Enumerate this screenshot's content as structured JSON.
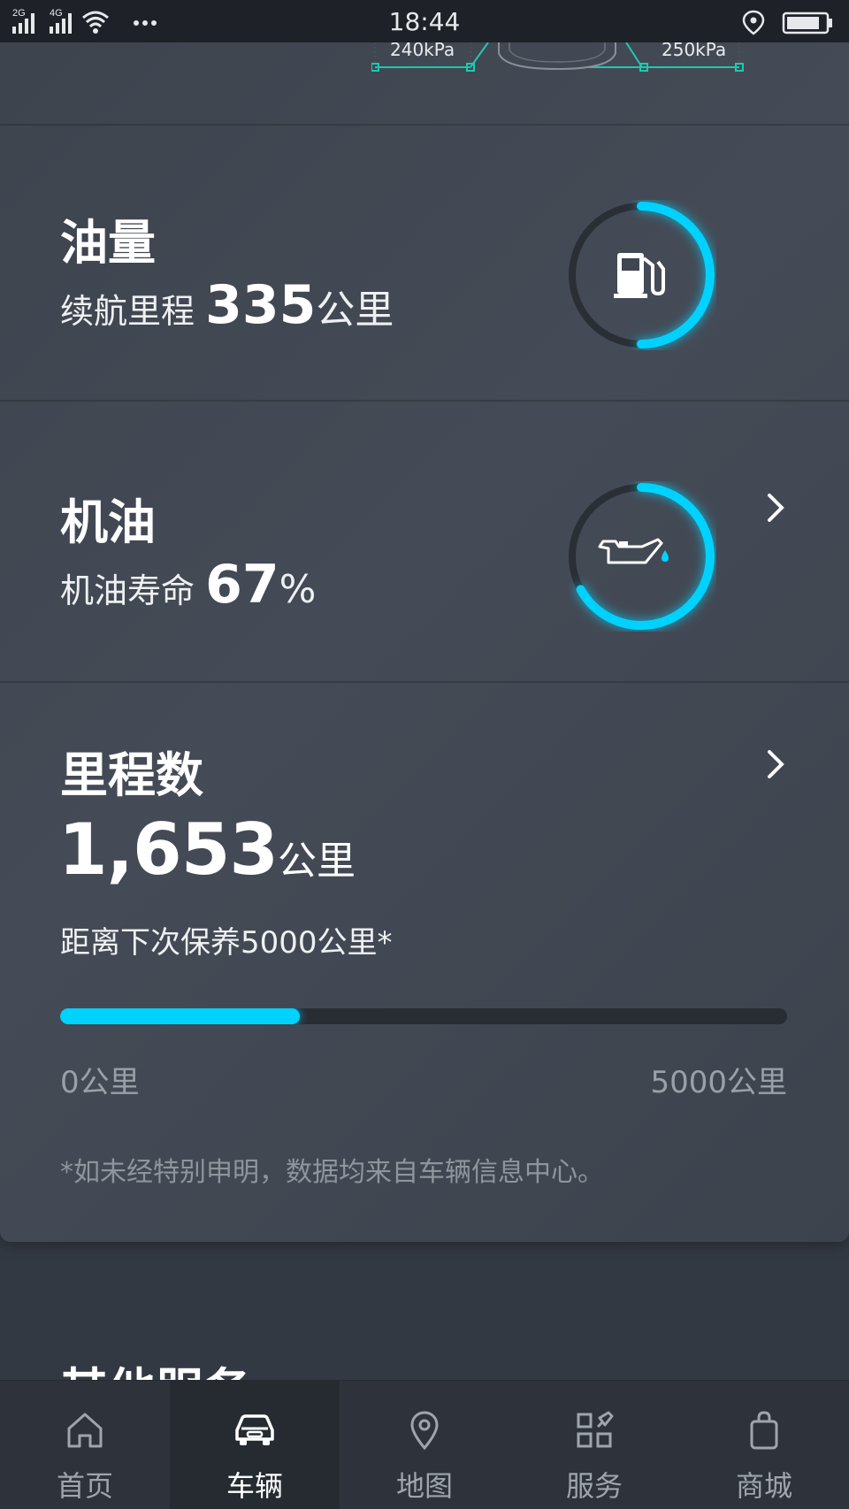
{
  "status_bar": {
    "signal_1": "2G",
    "signal_2": "4G",
    "time": "18:44"
  },
  "tire_pressure": {
    "left": "240kPa",
    "right": "250kPa"
  },
  "fuel": {
    "title": "油量",
    "range_label": "续航里程",
    "range_value": "335",
    "range_unit": "公里",
    "ring_fraction": 0.5,
    "icon": "fuel-pump-icon"
  },
  "oil": {
    "title": "机油",
    "life_label": "机油寿命",
    "life_value": "67",
    "life_unit": "%",
    "ring_fraction": 0.67,
    "icon": "oil-can-icon"
  },
  "odometer": {
    "title": "里程数",
    "value": "1,653",
    "unit": "公里",
    "next_service": "距离下次保养5000公里*",
    "progress_fraction": 0.33,
    "scale_min": "0公里",
    "scale_max": "5000公里",
    "footnote": "*如未经特别申明，数据均来自车辆信息中心。"
  },
  "other_services": {
    "title": "其他服务"
  },
  "bottom_nav": {
    "items": [
      {
        "label": "首页",
        "icon": "home-icon"
      },
      {
        "label": "车辆",
        "icon": "car-icon",
        "active": true
      },
      {
        "label": "地图",
        "icon": "map-pin-icon"
      },
      {
        "label": "服务",
        "icon": "services-grid-icon"
      },
      {
        "label": "商城",
        "icon": "shopping-bag-icon"
      }
    ]
  },
  "colors": {
    "accent": "#00d2ff",
    "card": "#424852",
    "track": "#262a30"
  }
}
